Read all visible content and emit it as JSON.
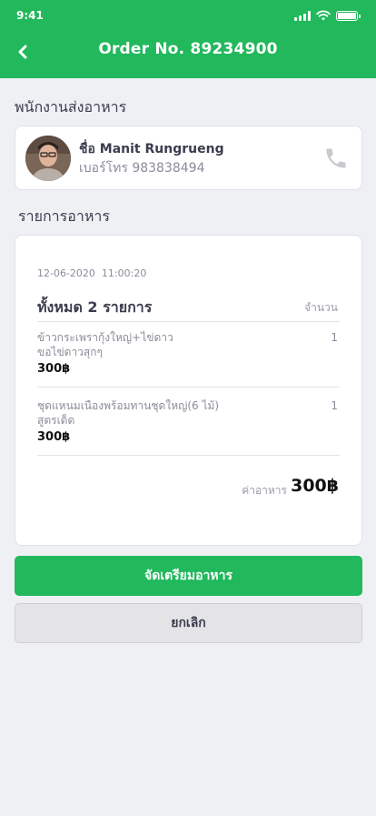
{
  "status_bar": {
    "time": "9:41"
  },
  "header": {
    "title": "Order No. 89234900"
  },
  "courier_section": {
    "title": "พนักงานส่งอาหาร"
  },
  "courier": {
    "name": "ชื่อ Manit Rungrueng",
    "phone": "เบอร์โทร 983838494"
  },
  "items_section": {
    "title": "รายการอาหาร"
  },
  "order": {
    "datetime": "12-06-2020  11:00:20",
    "total_label": "ทั้งหมด 2 รายการ",
    "qty_header": "จำนวน",
    "items": [
      {
        "name": "ข้าวกระเพรากุ้งใหญ่+ไข่ดาว\nขอไข่ดาวสุกๆ",
        "price": "300฿",
        "qty": "1"
      },
      {
        "name": "ชุดแหนมเนืองพร้อมทานชุดใหญ่(6 ไม้)\nสูตรเด็ด",
        "price": "300฿",
        "qty": "1"
      }
    ],
    "food_cost_label": "ค่าอาหาร",
    "food_cost_value": "300฿"
  },
  "buttons": {
    "prepare": "จัดเตรียมอาหาร",
    "cancel": "ยกเลิก"
  },
  "colors": {
    "primary": "#22b85c",
    "background": "#eff0f4"
  },
  "icons": {
    "back": "chevron-left-icon",
    "call": "phone-icon"
  }
}
